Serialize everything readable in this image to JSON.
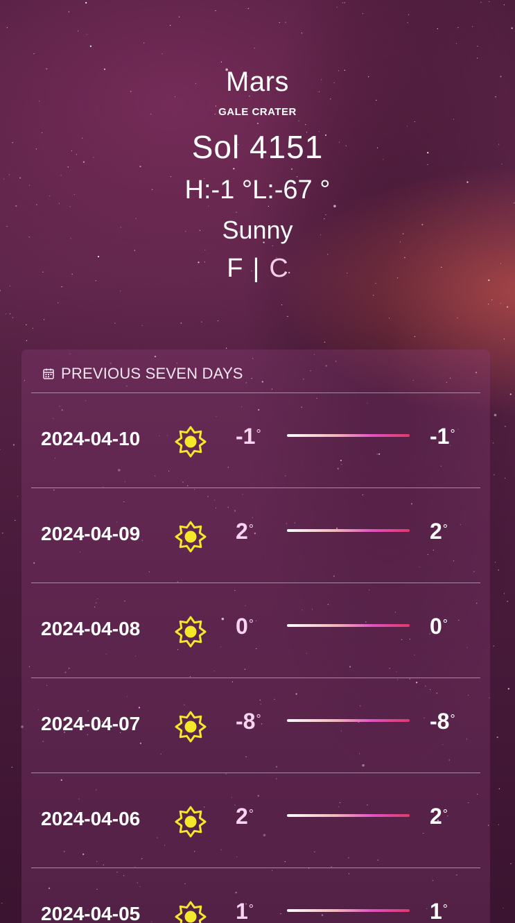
{
  "header": {
    "planet": "Mars",
    "location": "GALE CRATER",
    "sol": "Sol 4151",
    "high_low": "H:-1 °L:-67 °",
    "condition": "Sunny",
    "unit_f": "F",
    "unit_separator": "|",
    "unit_c": "C"
  },
  "forecast": {
    "title": "PREVIOUS SEVEN DAYS",
    "icon": "calendar-icon",
    "degree_symbol": "°",
    "days": [
      {
        "date": "2024-04-10",
        "icon": "sun-icon",
        "low": "-1",
        "high": "-1"
      },
      {
        "date": "2024-04-09",
        "icon": "sun-icon",
        "low": "2",
        "high": "2"
      },
      {
        "date": "2024-04-08",
        "icon": "sun-icon",
        "low": "0",
        "high": "0"
      },
      {
        "date": "2024-04-07",
        "icon": "sun-icon",
        "low": "-8",
        "high": "-8"
      },
      {
        "date": "2024-04-06",
        "icon": "sun-icon",
        "low": "2",
        "high": "2"
      },
      {
        "date": "2024-04-05",
        "icon": "sun-icon",
        "low": "1",
        "high": "1"
      }
    ]
  },
  "colors": {
    "sun": "#f4e82a",
    "low_temp": "#f8d4f0",
    "unit_inactive": "#f4cde6"
  }
}
